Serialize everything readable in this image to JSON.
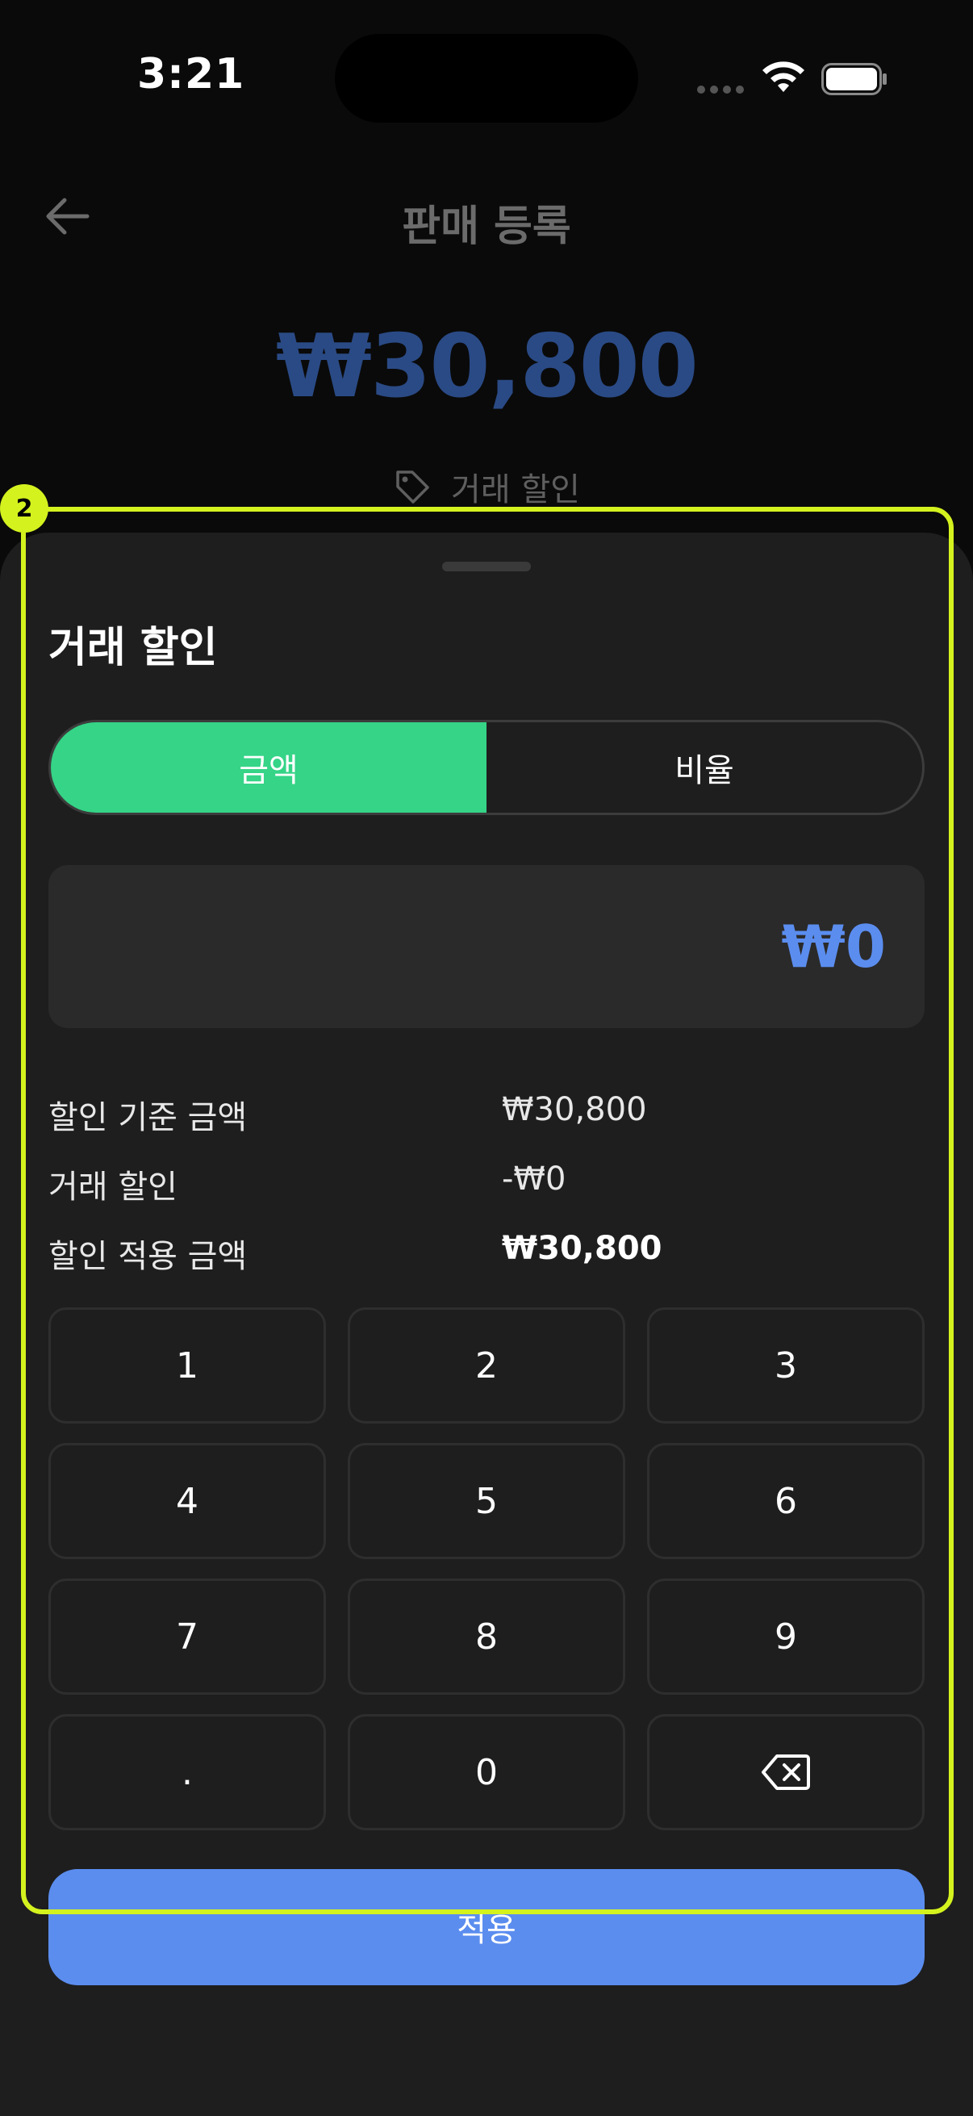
{
  "status_bar": {
    "time": "3:21"
  },
  "header": {
    "title": "판매 등록",
    "amount": "₩30,800",
    "discount_link": "거래 할인"
  },
  "sheet": {
    "title": "거래 할인",
    "tabs": [
      {
        "label": "금액",
        "active": true
      },
      {
        "label": "비율",
        "active": false
      }
    ],
    "input_value": "₩0",
    "summary": [
      {
        "label": "할인 기준 금액",
        "value": "₩30,800"
      },
      {
        "label": "거래 할인",
        "value": "-₩0"
      },
      {
        "label": "할인 적용 금액",
        "value": "₩30,800"
      }
    ],
    "keys": [
      "1",
      "2",
      "3",
      "4",
      "5",
      "6",
      "7",
      "8",
      "9",
      ".",
      "0"
    ],
    "backspace_icon": "backspace-icon",
    "apply_label": "적용"
  },
  "annotation": {
    "badge": "2"
  },
  "colors": {
    "accent_green": "#35d487",
    "accent_blue": "#5b8def",
    "highlight": "#d4f21e"
  }
}
